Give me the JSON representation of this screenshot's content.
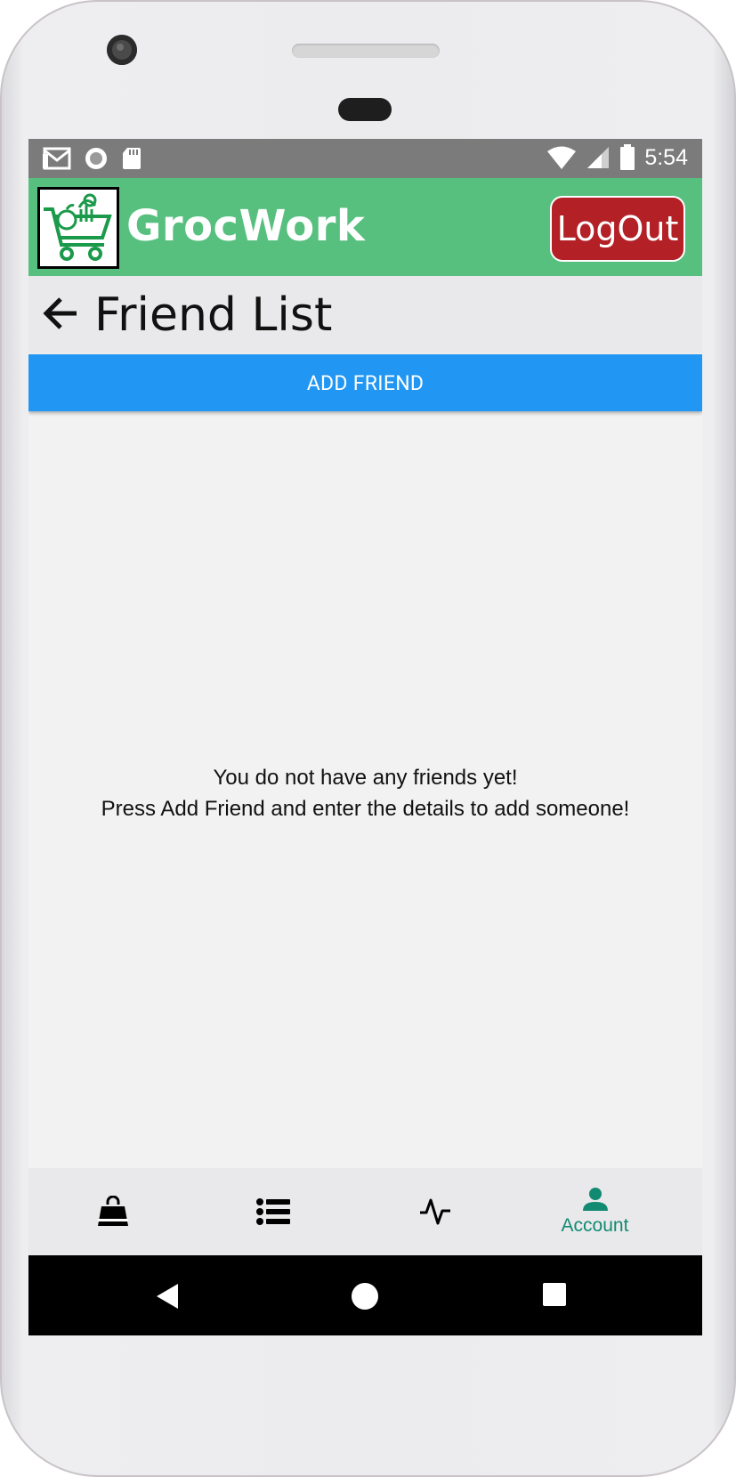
{
  "status_bar": {
    "time": "5:54",
    "left_icons": [
      "gmail-icon",
      "record-icon",
      "sd-card-icon"
    ],
    "right_icons": [
      "wifi-icon",
      "signal-icon",
      "battery-icon"
    ]
  },
  "app_bar": {
    "title": "GrocWork",
    "logout_label": "LogOut",
    "colors": {
      "background": "#57c07f",
      "logout": "#b32026"
    }
  },
  "header": {
    "title": "Friend List"
  },
  "add_friend": {
    "label": "ADD FRIEND",
    "color": "#2196f3"
  },
  "empty_state": {
    "line1": "You do not have any friends yet!",
    "line2": "Press Add Friend and enter the details to add someone!"
  },
  "bottom_nav": {
    "items": [
      {
        "icon": "shopping-bag-icon",
        "label": ""
      },
      {
        "icon": "list-icon",
        "label": ""
      },
      {
        "icon": "activity-icon",
        "label": ""
      },
      {
        "icon": "person-icon",
        "label": "Account",
        "active": true
      }
    ],
    "active_color": "#128a72"
  }
}
